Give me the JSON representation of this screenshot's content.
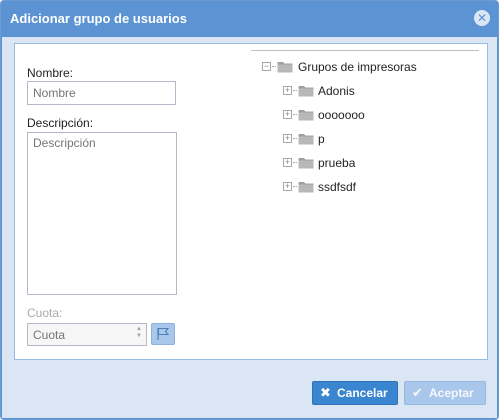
{
  "dialog": {
    "title": "Adicionar grupo de usuarios",
    "close_icon": "close-icon"
  },
  "form": {
    "name_label": "Nombre:",
    "name_placeholder": "Nombre",
    "name_value": "",
    "description_label": "Descripción:",
    "description_placeholder": "Descripción",
    "description_value": "",
    "quota_label": "Cuota:",
    "quota_placeholder": "Cuota",
    "quota_value": "",
    "quota_disabled": true,
    "quota_icon": "flag-icon"
  },
  "tree": {
    "root": {
      "label": "Grupos de impresoras",
      "expanded": true,
      "icon": "folder-icon"
    },
    "children": [
      {
        "label": "Adonis",
        "expanded": false,
        "icon": "folder-icon"
      },
      {
        "label": "ooooooo",
        "expanded": false,
        "icon": "folder-icon"
      },
      {
        "label": "p",
        "expanded": false,
        "icon": "folder-icon"
      },
      {
        "label": "prueba",
        "expanded": false,
        "icon": "folder-icon"
      },
      {
        "label": "ssdfsdf",
        "expanded": false,
        "icon": "folder-icon"
      }
    ]
  },
  "buttons": {
    "cancel_label": "Cancelar",
    "cancel_icon": "x-icon",
    "accept_label": "Aceptar",
    "accept_icon": "check-icon",
    "accept_disabled": true
  },
  "colors": {
    "title_bar": "#5b93d3",
    "body_background": "#dae6f4",
    "cancel_button": "#3a85d0",
    "accept_button_disabled": "#a9c7ea"
  }
}
